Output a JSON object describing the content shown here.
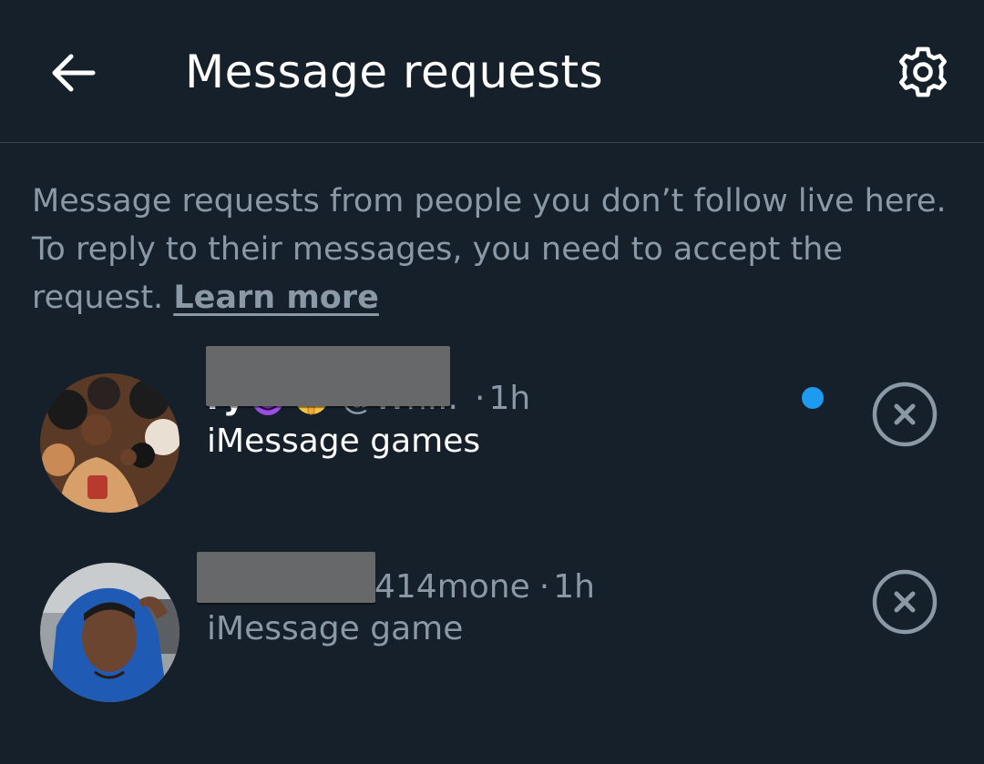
{
  "header": {
    "title": "Message requests",
    "back_icon": "arrow-left-icon",
    "settings_icon": "gear-icon"
  },
  "info": {
    "text": "Message requests from people you don’t follow live here. To reply to their messages, you need to accept the request.",
    "link": "Learn more"
  },
  "requests": [
    {
      "name_visible": "ry",
      "emojis": [
        "smiling-devil-emoji",
        "shushing-face-emoji"
      ],
      "handle": "@Wh...",
      "separator": "·",
      "time": "1h",
      "unread": true,
      "preview": "iMessage games",
      "dismiss_icon": "close-circle-icon"
    },
    {
      "handle": "414mone",
      "separator": "·",
      "time": "1h",
      "unread": false,
      "preview": "iMessage game",
      "dismiss_icon": "close-circle-icon"
    }
  ],
  "colors": {
    "background": "#15202b",
    "secondary_text": "#8b98a5",
    "unread_dot": "#1d9bf0",
    "divider": "#38444d"
  }
}
